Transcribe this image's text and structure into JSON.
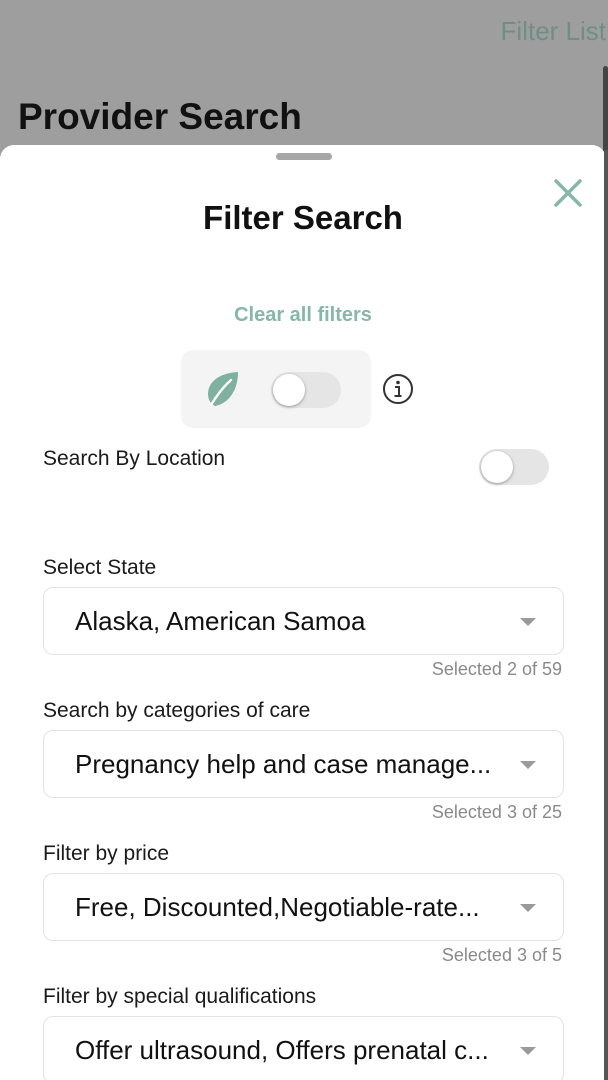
{
  "background": {
    "filter_list_label": "Filter List",
    "page_title": "Provider Search"
  },
  "sheet": {
    "title": "Filter Search",
    "clear_all": "Clear all filters",
    "eco_toggle_on": false,
    "search_by_location_label": "Search By Location",
    "search_by_location_on": false
  },
  "filters": [
    {
      "label": "Select State",
      "value": "Alaska, American Samoa",
      "count": "Selected 2 of 59"
    },
    {
      "label": "Search by categories of care",
      "value": "Pregnancy help and case manage...",
      "count": "Selected 3 of 25"
    },
    {
      "label": "Filter by price",
      "value": "Free, Discounted,Negotiable-rate...",
      "count": "Selected 3 of 5"
    },
    {
      "label": "Filter by special qualifications",
      "value": "Offer ultrasound, Offers prenatal c..."
    }
  ],
  "icons": {
    "close": "close-icon",
    "leaf": "leaf-icon",
    "info": "info-icon",
    "caret": "chevron-down-icon"
  },
  "colors": {
    "accent": "#86b7a8",
    "leaf": "#7fb0a0",
    "overlay": "#9e9e9e"
  }
}
